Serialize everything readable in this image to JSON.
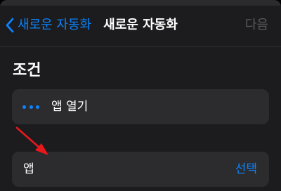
{
  "navbar": {
    "back_label": "새로운 자동화",
    "title": "새로운 자동화",
    "next_label": "다음"
  },
  "section": {
    "header": "조건"
  },
  "action_row": {
    "icon": "ellipsis-icon",
    "label": "앱 열기"
  },
  "app_row": {
    "label": "앱",
    "choose_label": "선택"
  },
  "colors": {
    "accent": "#0a84ff",
    "background": "#1c1c1e",
    "row": "#2c2c2e",
    "disabled": "#5a5a5e",
    "annotation_arrow": "#e8171c"
  }
}
